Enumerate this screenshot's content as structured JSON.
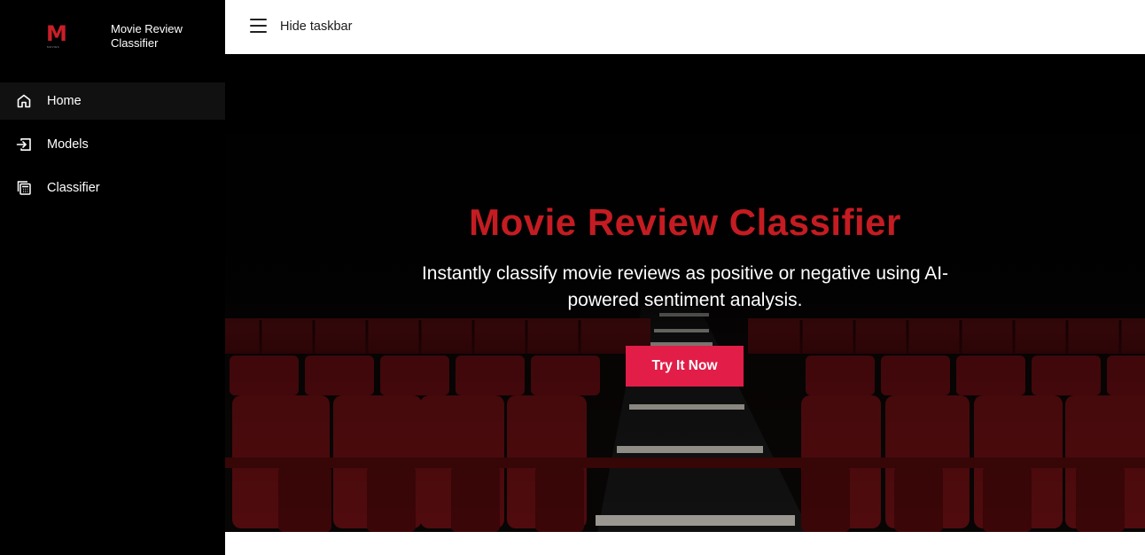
{
  "brand": {
    "logo_letter": "M",
    "logo_subtext": "MOVIES",
    "title": "Movie Review Classifier"
  },
  "sidebar": {
    "items": [
      {
        "label": "Home",
        "icon": "home-icon",
        "active": true
      },
      {
        "label": "Models",
        "icon": "login-icon",
        "active": false
      },
      {
        "label": "Classifier",
        "icon": "calculator-icon",
        "active": false
      }
    ]
  },
  "topbar": {
    "menu_icon": "hamburger-menu-icon",
    "toggle_label": "Hide taskbar"
  },
  "hero": {
    "title": "Movie Review Classifier",
    "subtitle": "Instantly classify movie reviews as positive or negative using AI-powered sentiment analysis.",
    "cta_label": "Try It Now",
    "background": "cinema-seats-image"
  },
  "colors": {
    "sidebar_bg": "#000000",
    "active_item_bg": "#111111",
    "accent_red": "#c41c22",
    "button_bg": "#e11d48",
    "seat_red": "#5e0d10"
  }
}
